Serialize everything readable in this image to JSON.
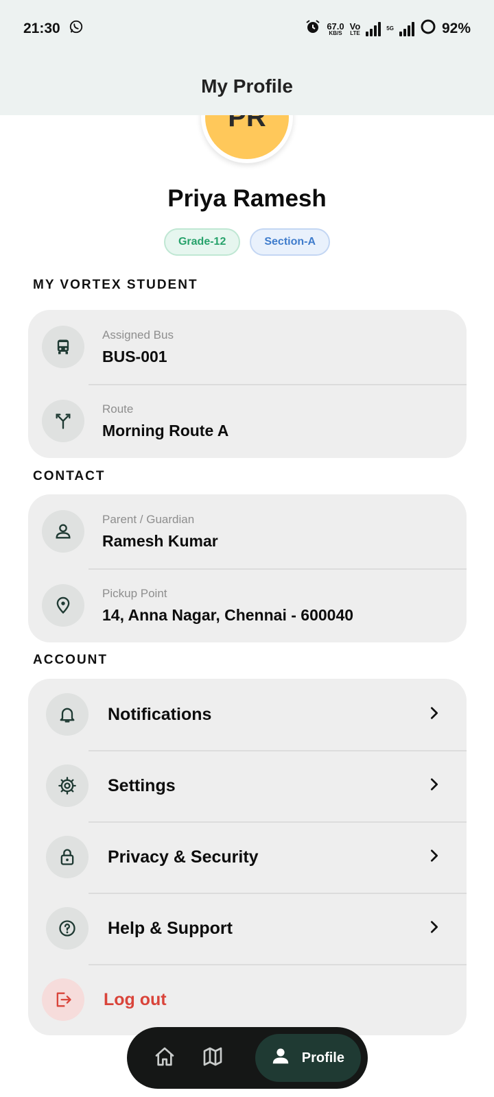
{
  "status_bar": {
    "time": "21:30",
    "speed_value": "67.0",
    "speed_unit": "KB/S",
    "volte_top": "Vo",
    "volte_bottom": "LTE",
    "net_5g": "5G",
    "battery": "92%"
  },
  "header": {
    "title": "My Profile"
  },
  "profile": {
    "initials": "PR",
    "name": "Priya Ramesh",
    "grade": "Grade-12",
    "section": "Section-A"
  },
  "student": {
    "section_title": "MY VORTEX STUDENT",
    "rows": [
      {
        "label": "Assigned Bus",
        "value": "BUS-001",
        "icon": "bus-icon"
      },
      {
        "label": "Route",
        "value": "Morning Route A",
        "icon": "route-icon"
      }
    ]
  },
  "contact": {
    "section_title": "CONTACT",
    "rows": [
      {
        "label": "Parent / Guardian",
        "value": "Ramesh Kumar",
        "icon": "person-icon"
      },
      {
        "label": "Pickup Point",
        "value": "14, Anna Nagar, Chennai - 600040",
        "icon": "location-pin-icon"
      }
    ]
  },
  "account": {
    "section_title": "ACCOUNT",
    "items": [
      {
        "label": "Notifications",
        "icon": "bell-icon"
      },
      {
        "label": "Settings",
        "icon": "gear-icon"
      },
      {
        "label": "Privacy & Security",
        "icon": "lock-icon"
      },
      {
        "label": "Help & Support",
        "icon": "help-icon"
      }
    ],
    "logout_label": "Log out"
  },
  "nav": {
    "items": [
      {
        "icon": "home-icon"
      },
      {
        "icon": "map-icon"
      }
    ],
    "active_label": "Profile",
    "active_icon": "person-icon"
  },
  "colors": {
    "accent_dark": "#1f3a33",
    "avatar_bg": "#ffc85a",
    "logout_red": "#d9443a",
    "grade_green": "#27a26b",
    "section_blue": "#3f7ccc",
    "header_bg": "#edf2f1"
  }
}
